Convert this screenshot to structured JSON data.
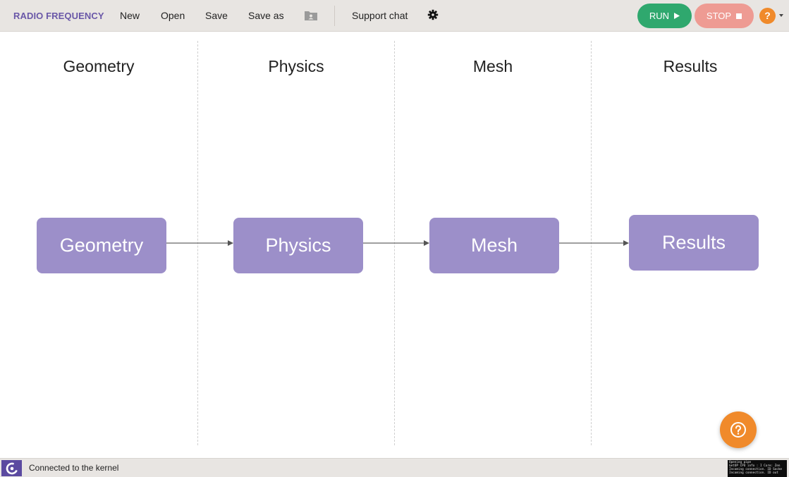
{
  "toolbar": {
    "brand": "RADIO FREQUENCY",
    "new_label": "New",
    "open_label": "Open",
    "save_label": "Save",
    "saveas_label": "Save as",
    "folder_icon": "folder-user-icon",
    "support_label": "Support chat",
    "settings_icon": "gear-icon",
    "run_label": "RUN",
    "stop_label": "STOP",
    "help_label": "?",
    "colors": {
      "brand": "#6a58a8",
      "run": "#2fa86e",
      "stop": "#ee9b93",
      "help": "#f08a2b"
    }
  },
  "workflow": {
    "columns": [
      {
        "header": "Geometry",
        "node": "Geometry"
      },
      {
        "header": "Physics",
        "node": "Physics"
      },
      {
        "header": "Mesh",
        "node": "Mesh"
      },
      {
        "header": "Results",
        "node": "Results"
      }
    ],
    "node_color": "#9c8fc9"
  },
  "floating_help": {
    "icon": "question-circle-icon"
  },
  "statusbar": {
    "logo_icon": "app-logo-icon",
    "status": "Connected to the kernel",
    "console_lines": [
      "Opening pipe",
      "GetOP CPU info : I Core: Zen",
      "Incoming connection. ID Socke",
      "Incoming connection. ID out"
    ]
  }
}
